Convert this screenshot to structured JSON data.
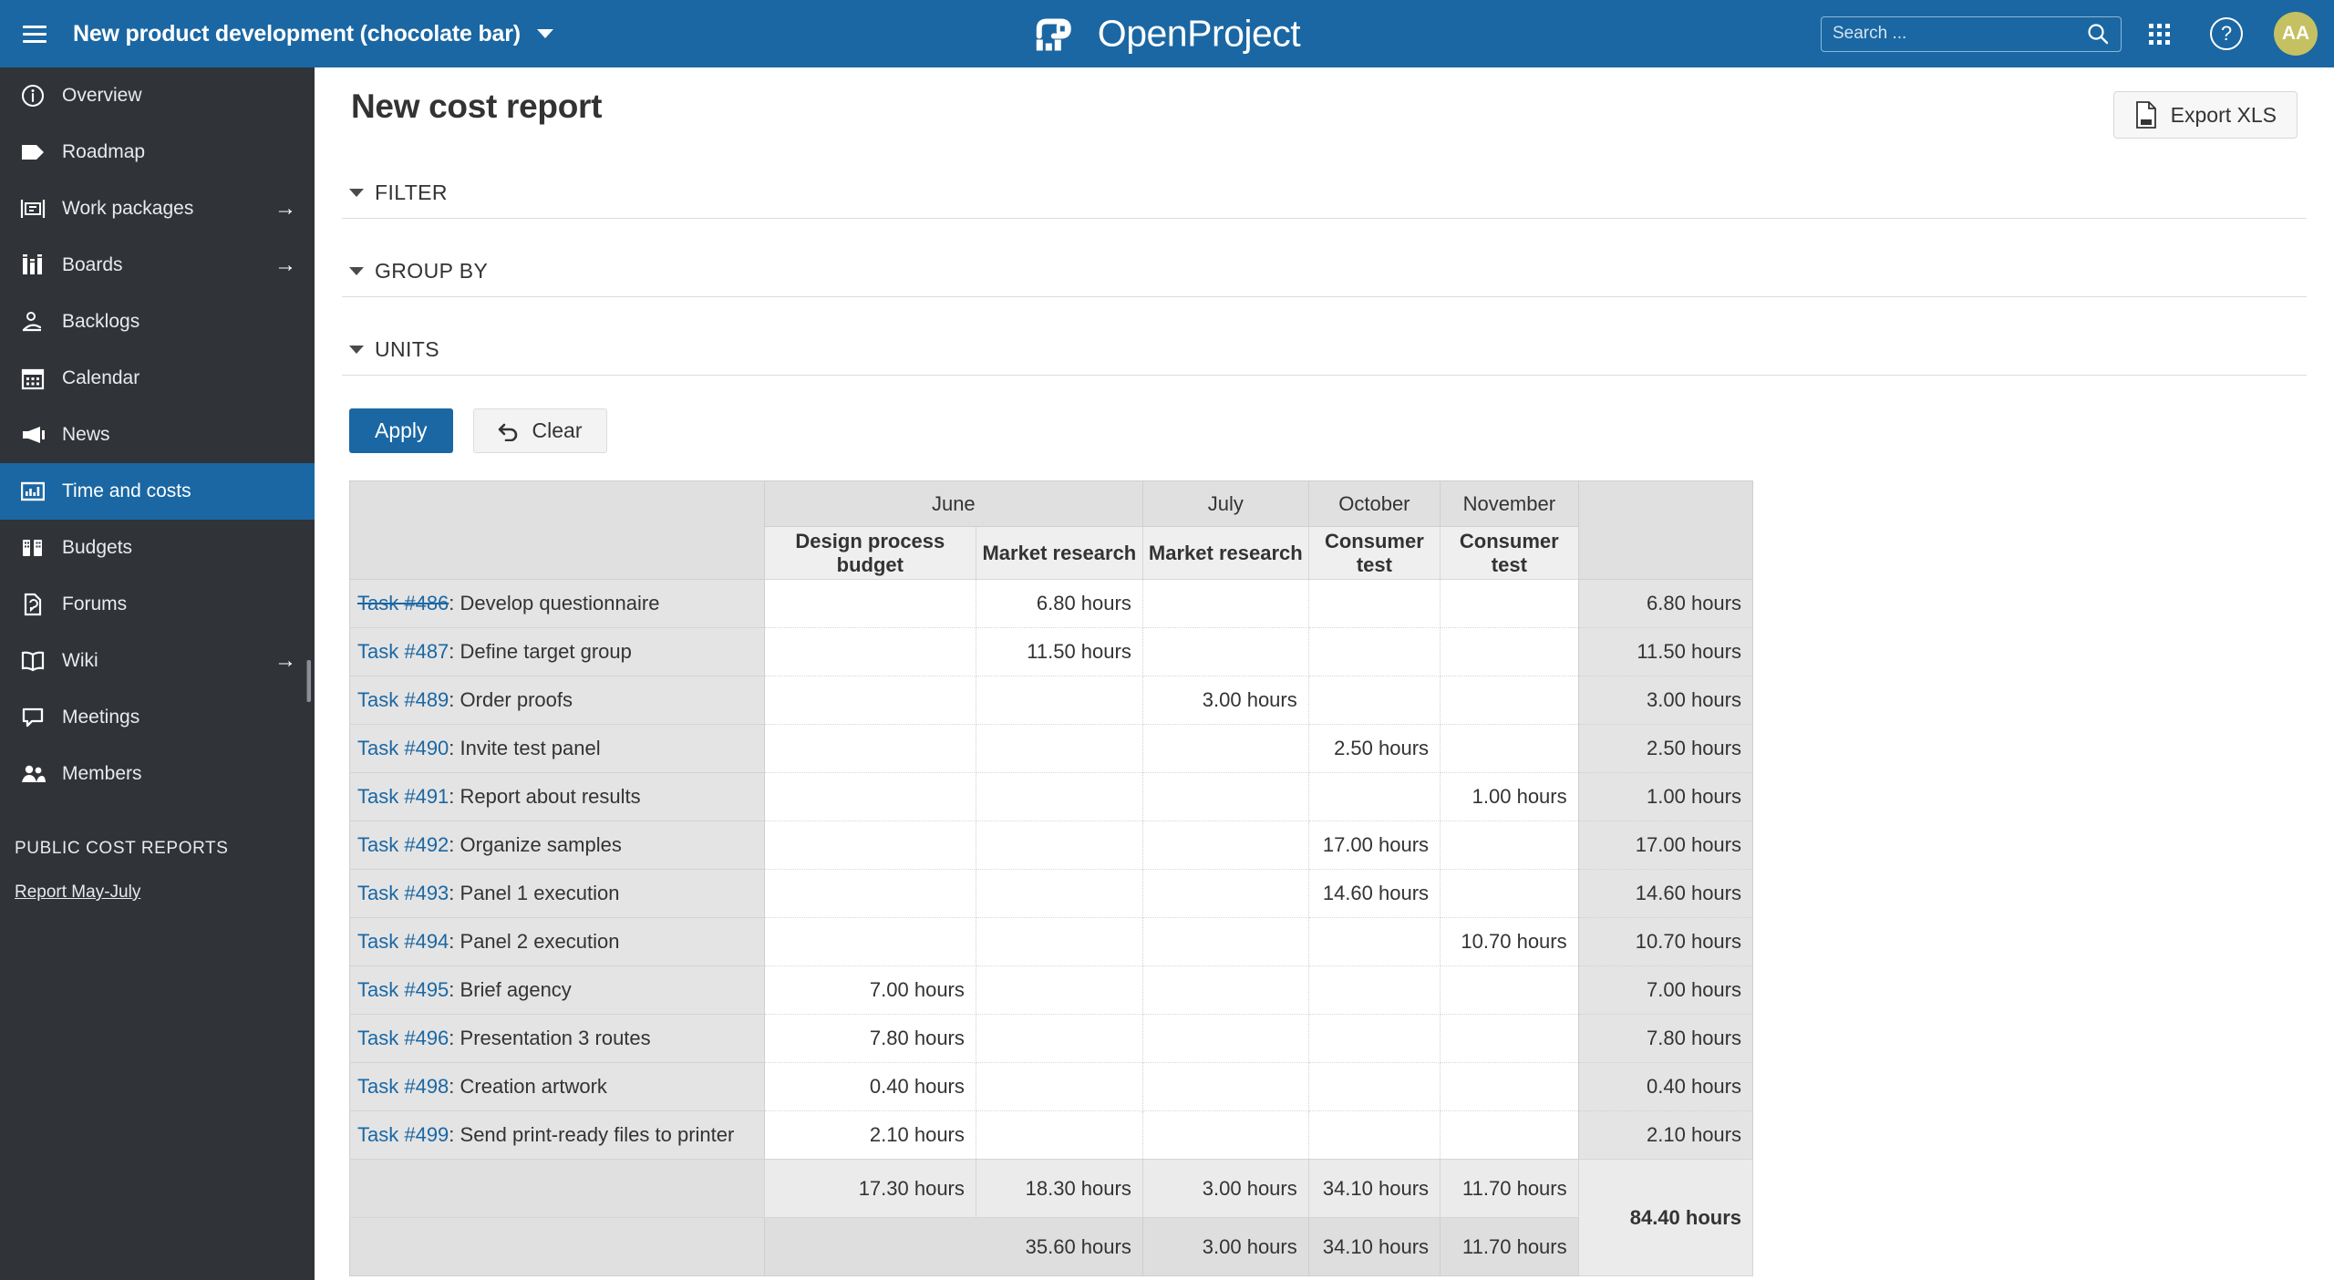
{
  "topbar": {
    "project_name": "New product development (chocolate bar)",
    "logo_text": "OpenProject",
    "search_placeholder": "Search ...",
    "search_value": "",
    "avatar_initials": "AA",
    "help_glyph": "?",
    "accent_color": "#1A67A3",
    "avatar_color": "#C5C062"
  },
  "sidebar": {
    "items": [
      {
        "label": "Overview",
        "icon": "info-circle-icon",
        "arrow": "",
        "active": false
      },
      {
        "label": "Roadmap",
        "icon": "tag-icon",
        "arrow": "",
        "active": false
      },
      {
        "label": "Work packages",
        "icon": "work-packages-icon",
        "arrow": "→",
        "active": false
      },
      {
        "label": "Boards",
        "icon": "boards-icon",
        "arrow": "→",
        "active": false
      },
      {
        "label": "Backlogs",
        "icon": "backlogs-icon",
        "arrow": "",
        "active": false
      },
      {
        "label": "Calendar",
        "icon": "calendar-icon",
        "arrow": "",
        "active": false
      },
      {
        "label": "News",
        "icon": "megaphone-icon",
        "arrow": "",
        "active": false
      },
      {
        "label": "Time and costs",
        "icon": "chart-bars-icon",
        "arrow": "",
        "active": true
      },
      {
        "label": "Budgets",
        "icon": "budgets-icon",
        "arrow": "",
        "active": false
      },
      {
        "label": "Forums",
        "icon": "forums-icon",
        "arrow": "",
        "active": false
      },
      {
        "label": "Wiki",
        "icon": "book-icon",
        "arrow": "→",
        "active": false
      },
      {
        "label": "Meetings",
        "icon": "speech-bubble-icon",
        "arrow": "",
        "active": false
      },
      {
        "label": "Members",
        "icon": "people-icon",
        "arrow": "",
        "active": false
      }
    ],
    "section_title": "PUBLIC COST REPORTS",
    "reports": [
      {
        "label": "Report May-July"
      }
    ]
  },
  "page": {
    "title": "New cost report",
    "export_label": "Export XLS"
  },
  "filters": {
    "sections": [
      {
        "label": "FILTER"
      },
      {
        "label": "GROUP BY"
      },
      {
        "label": "UNITS"
      }
    ],
    "apply_label": "Apply",
    "clear_label": "Clear"
  },
  "chart_data": {
    "type": "table",
    "title": "New cost report",
    "unit": "hours",
    "month_groups": [
      {
        "month": "June",
        "span": 2
      },
      {
        "month": "July",
        "span": 1
      },
      {
        "month": "October",
        "span": 1
      },
      {
        "month": "November",
        "span": 1
      }
    ],
    "budget_columns": [
      "Design process budget",
      "Market research",
      "Market research",
      "Consumer test",
      "Consumer test"
    ],
    "rows": [
      {
        "id": "Task #486",
        "closed": true,
        "name": "Develop questionnaire",
        "values": [
          "",
          "6.80 hours",
          "",
          "",
          ""
        ],
        "total": "6.80 hours"
      },
      {
        "id": "Task #487",
        "closed": false,
        "name": "Define target group",
        "values": [
          "",
          "11.50 hours",
          "",
          "",
          ""
        ],
        "total": "11.50 hours"
      },
      {
        "id": "Task #489",
        "closed": false,
        "name": "Order proofs",
        "values": [
          "",
          "",
          "3.00 hours",
          "",
          ""
        ],
        "total": "3.00 hours"
      },
      {
        "id": "Task #490",
        "closed": false,
        "name": "Invite test panel",
        "values": [
          "",
          "",
          "",
          "2.50 hours",
          ""
        ],
        "total": "2.50 hours"
      },
      {
        "id": "Task #491",
        "closed": false,
        "name": "Report about results",
        "values": [
          "",
          "",
          "",
          "",
          "1.00 hours"
        ],
        "total": "1.00 hours"
      },
      {
        "id": "Task #492",
        "closed": false,
        "name": "Organize samples",
        "values": [
          "",
          "",
          "",
          "17.00 hours",
          ""
        ],
        "total": "17.00 hours"
      },
      {
        "id": "Task #493",
        "closed": false,
        "name": "Panel 1 execution",
        "values": [
          "",
          "",
          "",
          "14.60 hours",
          ""
        ],
        "total": "14.60 hours"
      },
      {
        "id": "Task #494",
        "closed": false,
        "name": "Panel 2 execution",
        "values": [
          "",
          "",
          "",
          "",
          "10.70 hours"
        ],
        "total": "10.70 hours"
      },
      {
        "id": "Task #495",
        "closed": false,
        "name": "Brief agency",
        "values": [
          "7.00 hours",
          "",
          "",
          "",
          ""
        ],
        "total": "7.00 hours"
      },
      {
        "id": "Task #496",
        "closed": false,
        "name": "Presentation 3 routes",
        "values": [
          "7.80 hours",
          "",
          "",
          "",
          ""
        ],
        "total": "7.80 hours"
      },
      {
        "id": "Task #498",
        "closed": false,
        "name": "Creation artwork",
        "values": [
          "0.40 hours",
          "",
          "",
          "",
          ""
        ],
        "total": "0.40 hours"
      },
      {
        "id": "Task #499",
        "closed": false,
        "name": "Send print-ready files to printer",
        "values": [
          "2.10 hours",
          "",
          "",
          "",
          ""
        ],
        "total": "2.10 hours"
      }
    ],
    "budget_totals": [
      "17.30 hours",
      "18.30 hours",
      "3.00 hours",
      "34.10 hours",
      "11.70 hours"
    ],
    "month_totals": [
      {
        "label": "35.60 hours",
        "span": 2
      },
      {
        "label": "3.00 hours",
        "span": 1
      },
      {
        "label": "34.10 hours",
        "span": 1
      },
      {
        "label": "11.70 hours",
        "span": 1
      }
    ],
    "grand_total": "84.40 hours"
  }
}
